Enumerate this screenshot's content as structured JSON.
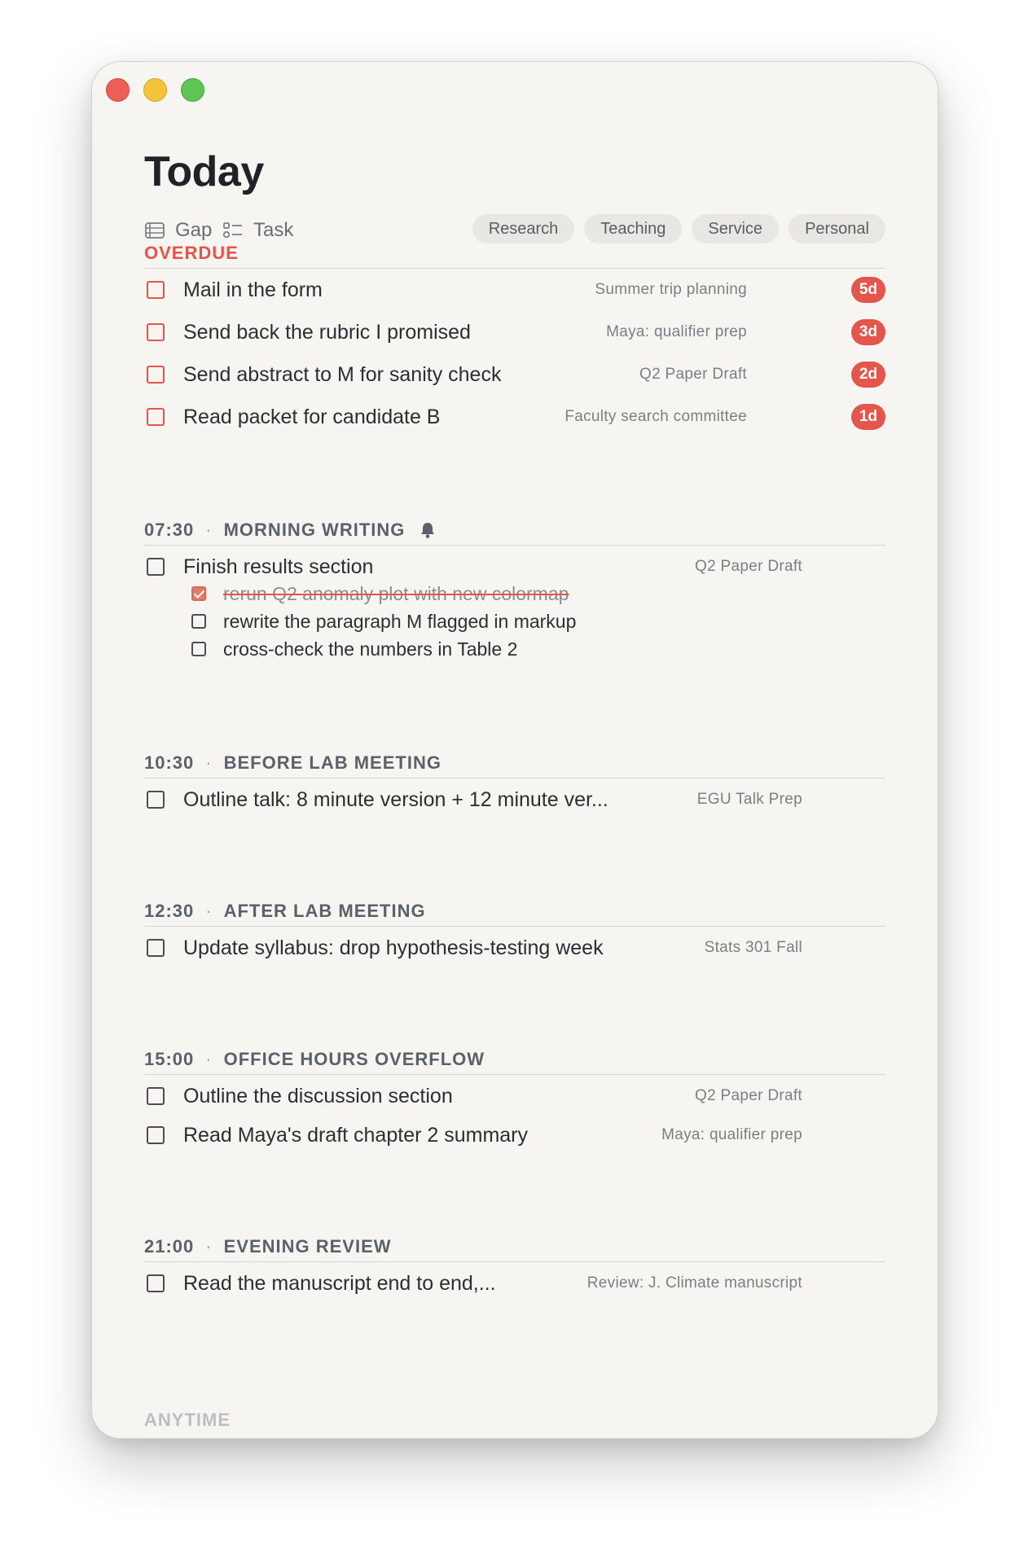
{
  "title": "Today",
  "toolbar": {
    "gap_label": "Gap",
    "task_label": "Task",
    "filters": [
      "Research",
      "Teaching",
      "Service",
      "Personal"
    ]
  },
  "overdue": {
    "heading": "OVERDUE",
    "tasks": [
      {
        "title": "Mail in the form",
        "project": "Summer trip planning",
        "badge": "5d"
      },
      {
        "title": "Send back the rubric I promised",
        "project": "Maya: qualifier prep",
        "badge": "3d"
      },
      {
        "title": "Send abstract to M for sanity check",
        "project": "Q2 Paper Draft",
        "badge": "2d"
      },
      {
        "title": "Read packet for candidate B",
        "project": "Faculty search committee",
        "badge": "1d"
      }
    ]
  },
  "blocks": [
    {
      "time": "07:30",
      "name": "MORNING WRITING",
      "bell": true,
      "tasks": [
        {
          "title": "Finish results section",
          "project": "Q2 Paper Draft",
          "subtasks": [
            {
              "title": "rerun Q2 anomaly plot with new colormap",
              "done": true
            },
            {
              "title": "rewrite the paragraph M flagged in markup",
              "done": false
            },
            {
              "title": "cross-check the numbers in Table 2",
              "done": false
            }
          ]
        }
      ]
    },
    {
      "time": "10:30",
      "name": "BEFORE LAB MEETING",
      "tasks": [
        {
          "title": "Outline talk: 8 minute version + 12 minute ver...",
          "project": "EGU Talk Prep"
        }
      ]
    },
    {
      "time": "12:30",
      "name": "AFTER LAB MEETING",
      "tasks": [
        {
          "title": "Update syllabus: drop hypothesis-testing week",
          "project": "Stats 301 Fall"
        }
      ]
    },
    {
      "time": "15:00",
      "name": "OFFICE HOURS OVERFLOW",
      "tasks": [
        {
          "title": "Outline the discussion section",
          "project": "Q2 Paper Draft"
        },
        {
          "title": "Read Maya's draft chapter 2 summary",
          "project": "Maya: qualifier prep"
        }
      ]
    },
    {
      "time": "21:00",
      "name": "EVENING REVIEW",
      "tasks": [
        {
          "title": "Read the manuscript end to end,...",
          "project": "Review: J. Climate manuscript"
        }
      ]
    }
  ],
  "anytime_heading": "ANYTIME",
  "colors": {
    "accent_red": "#e4554b",
    "window_bg": "#f6f5f2"
  },
  "icons": [
    "gap-icon",
    "task-icon",
    "bell-icon"
  ]
}
